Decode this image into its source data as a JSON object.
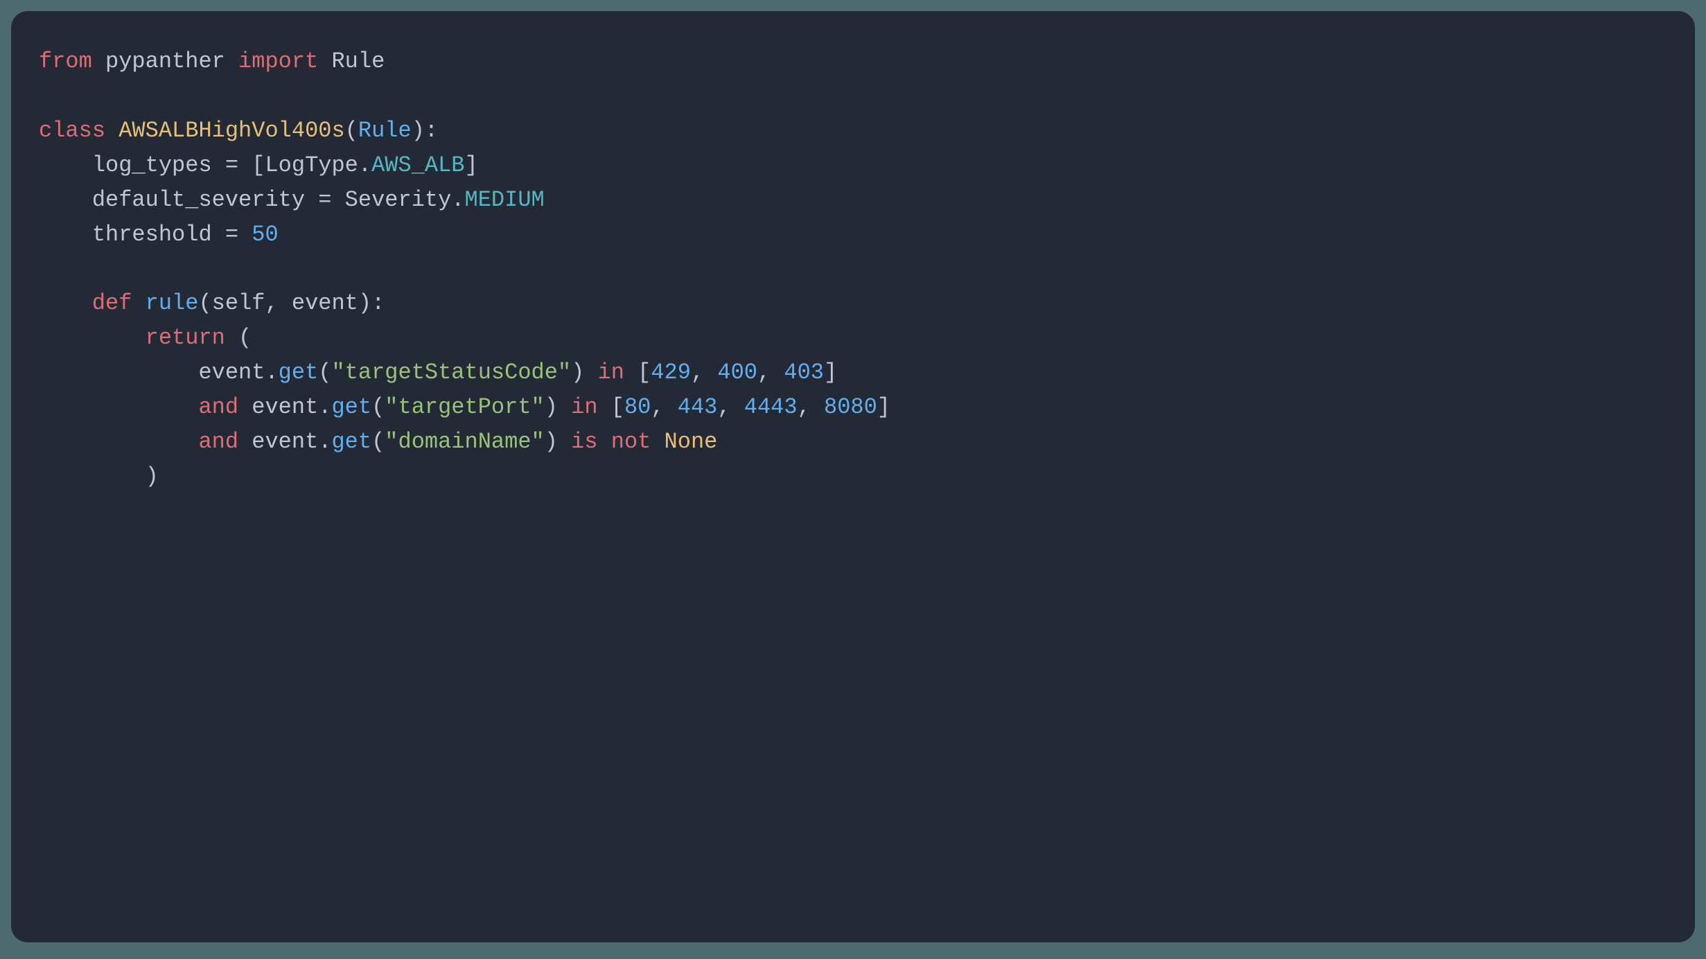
{
  "code": {
    "line1": {
      "kw_from": "from",
      "mod": "pypanther",
      "kw_import": "import",
      "name": "Rule"
    },
    "line3": {
      "kw_class": "class",
      "cls_name": "AWSALBHighVol400s",
      "base": "Rule"
    },
    "line4": {
      "var": "log_types",
      "eq": " = [",
      "obj": "LogType",
      "dot": ".",
      "attr": "AWS_ALB",
      "close": "]"
    },
    "line5": {
      "var": "default_severity",
      "eq": " = ",
      "obj": "Severity",
      "dot": ".",
      "attr": "MEDIUM"
    },
    "line6": {
      "var": "threshold",
      "eq": " = ",
      "val": "50"
    },
    "line8": {
      "kw_def": "def",
      "fn": "rule",
      "params_open": "(",
      "p1": "self",
      "comma": ", ",
      "p2": "event",
      "params_close": "):"
    },
    "line9": {
      "kw_return": "return",
      "open": " ("
    },
    "line10": {
      "obj": "event",
      "dot": ".",
      "method": "get",
      "open": "(",
      "arg": "\"targetStatusCode\"",
      "close": ") ",
      "kw_in": "in",
      "list_open": " [",
      "n1": "429",
      "c1": ", ",
      "n2": "400",
      "c2": ", ",
      "n3": "403",
      "list_close": "]"
    },
    "line11": {
      "kw_and": "and",
      "sp": " ",
      "obj": "event",
      "dot": ".",
      "method": "get",
      "open": "(",
      "arg": "\"targetPort\"",
      "close": ") ",
      "kw_in": "in",
      "list_open": " [",
      "n1": "80",
      "c1": ", ",
      "n2": "443",
      "c2": ", ",
      "n3": "4443",
      "c3": ", ",
      "n4": "8080",
      "list_close": "]"
    },
    "line12": {
      "kw_and": "and",
      "sp": " ",
      "obj": "event",
      "dot": ".",
      "method": "get",
      "open": "(",
      "arg": "\"domainName\"",
      "close": ") ",
      "kw_is": "is",
      "sp2": " ",
      "kw_not": "not",
      "sp3": " ",
      "none": "None"
    },
    "line13": {
      "close": ")"
    }
  }
}
